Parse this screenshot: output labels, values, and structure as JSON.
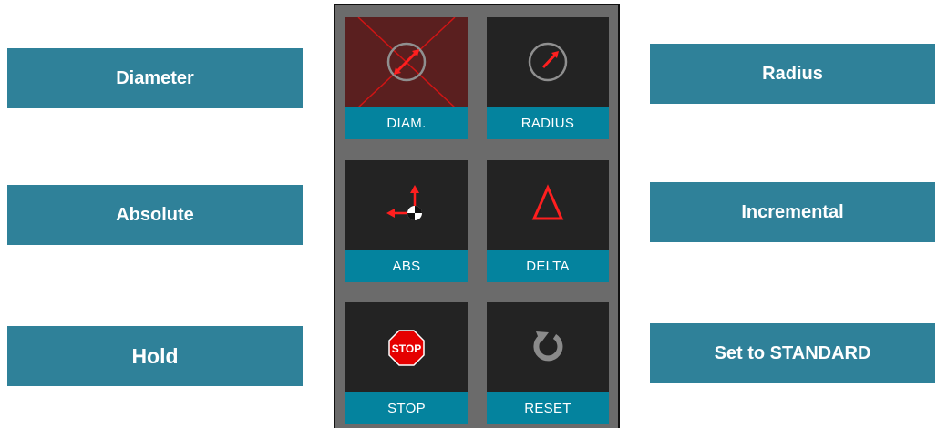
{
  "labels_left": [
    {
      "text": "Diameter"
    },
    {
      "text": "Absolute"
    },
    {
      "text": "Hold"
    }
  ],
  "labels_right": [
    {
      "text": "Radius"
    },
    {
      "text": "Incremental"
    },
    {
      "text": "Set to STANDARD"
    }
  ],
  "buttons": [
    {
      "caption": "DIAM.",
      "icon": "diameter-icon",
      "active": true
    },
    {
      "caption": "RADIUS",
      "icon": "radius-icon",
      "active": false
    },
    {
      "caption": "ABS",
      "icon": "absolute-icon",
      "active": false
    },
    {
      "caption": "DELTA",
      "icon": "delta-icon",
      "active": false
    },
    {
      "caption": "STOP",
      "icon": "stop-sign-icon",
      "active": false,
      "icon_text": "STOP"
    },
    {
      "caption": "RESET",
      "icon": "reset-icon",
      "active": false
    }
  ],
  "colors": {
    "label_bg": "#2f8199",
    "caption_bg": "#04839e",
    "tile_bg": "#232323",
    "panel_bg": "#6b6b6b",
    "accent_red": "#e00000"
  }
}
